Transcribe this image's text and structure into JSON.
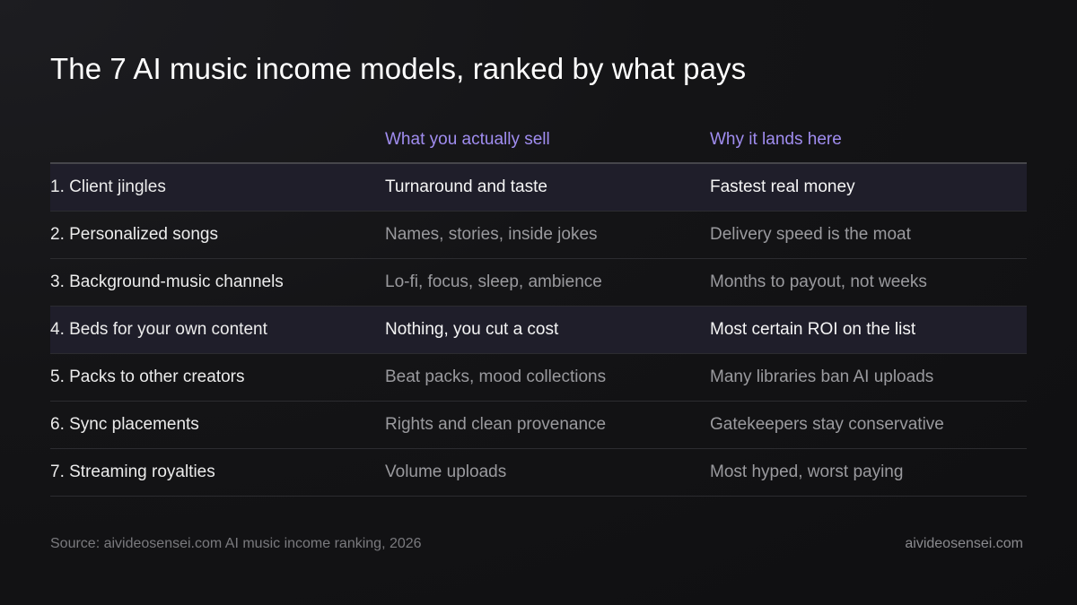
{
  "title": "The 7 AI music income models, ranked by what pays",
  "columns": [
    "",
    "What you actually sell",
    "Why it lands here"
  ],
  "rows": [
    {
      "model": "1. Client jingles",
      "sell": "Turnaround and taste",
      "why": "Fastest real money"
    },
    {
      "model": "2. Personalized songs",
      "sell": "Names, stories, inside jokes",
      "why": "Delivery speed is the moat"
    },
    {
      "model": "3. Background-music channels",
      "sell": "Lo-fi, focus, sleep, ambience",
      "why": "Months to payout, not weeks"
    },
    {
      "model": "4. Beds for your own content",
      "sell": "Nothing, you cut a cost",
      "why": "Most certain ROI on the list"
    },
    {
      "model": "5. Packs to other creators",
      "sell": "Beat packs, mood collections",
      "why": "Many libraries ban AI uploads"
    },
    {
      "model": "6. Sync placements",
      "sell": "Rights and clean provenance",
      "why": "Gatekeepers stay conservative"
    },
    {
      "model": "7. Streaming royalties",
      "sell": "Volume uploads",
      "why": "Most hyped, worst paying"
    }
  ],
  "footer": {
    "source": "Source: aivideosensei.com AI music income ranking, 2026",
    "brand": "aivideosensei.com"
  },
  "colors": {
    "background": "#121214",
    "header_accent": "#a08df0",
    "highlight_row": "#1f1e2a",
    "muted_text": "#9a9a9e"
  }
}
